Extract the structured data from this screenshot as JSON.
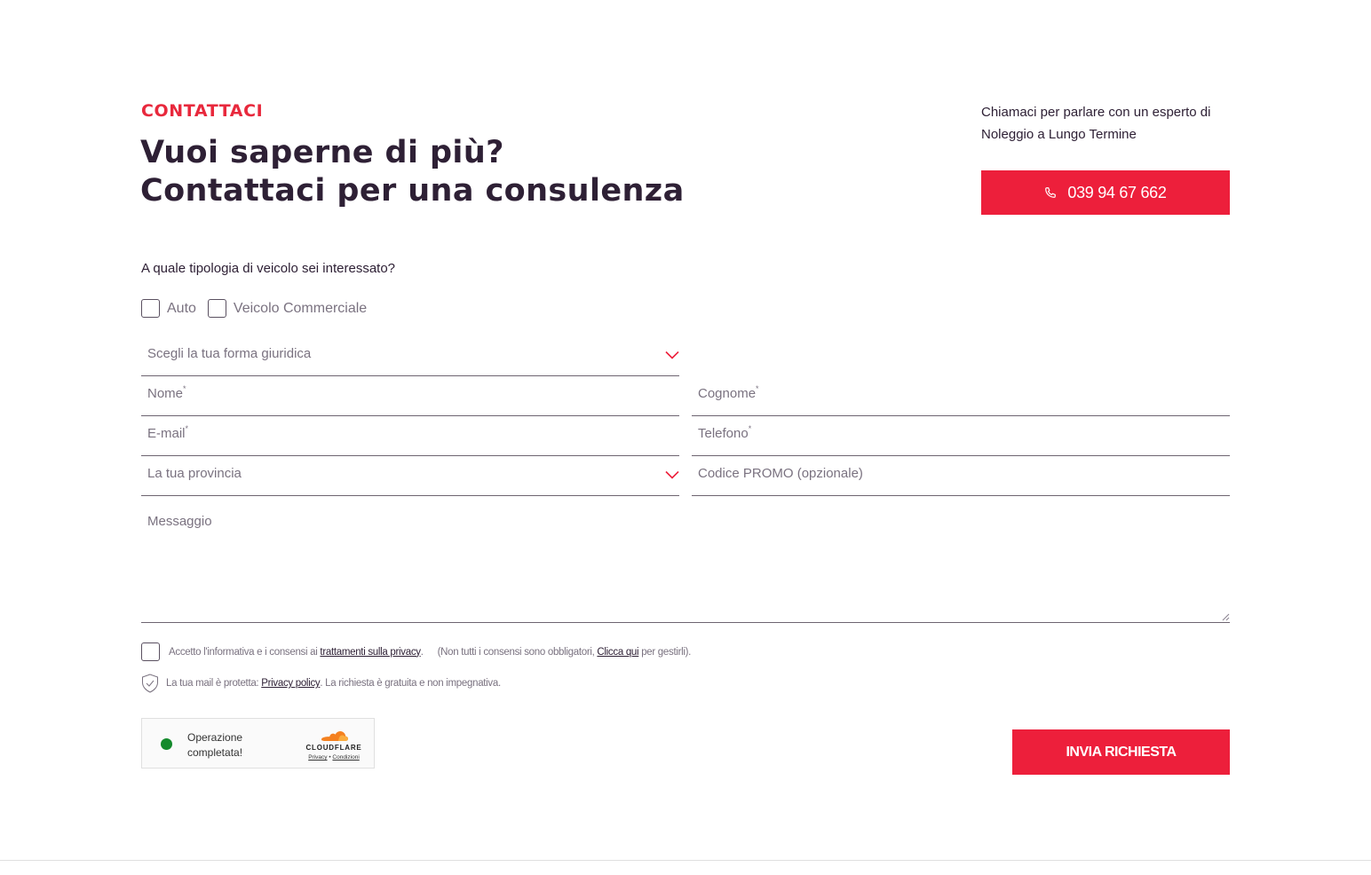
{
  "header": {
    "eyebrow": "CONTATTACI",
    "headline_line1": "Vuoi saperne di più?",
    "headline_line2": "Contattaci per una consulenza"
  },
  "callout": {
    "text_line1": "Chiamaci per parlare con un esperto di",
    "text_line2": "Noleggio a Lungo Termine",
    "phone_number": "039 94 67 662",
    "phone_icon": "phone-icon"
  },
  "form": {
    "vehicle_question": "A quale tipologia di veicolo sei interessato?",
    "vehicle_options": [
      {
        "label": "Auto",
        "checked": false
      },
      {
        "label": "Veicolo Commerciale",
        "checked": false
      }
    ],
    "legal_form": {
      "label": "Scegli la tua forma giuridica",
      "icon": "chevron-down-icon"
    },
    "first_name": {
      "label": "Nome",
      "required_mark": "*"
    },
    "last_name": {
      "label": "Cognome",
      "required_mark": "*"
    },
    "email": {
      "label": "E-mail",
      "required_mark": "*"
    },
    "phone": {
      "label": "Telefono",
      "required_mark": "*"
    },
    "province": {
      "label": "La tua provincia",
      "icon": "chevron-down-icon"
    },
    "promo": {
      "label": "Codice PROMO (opzionale)"
    },
    "message": {
      "label": "Messaggio"
    },
    "consent": {
      "prefix": "Accetto l'informativa e i consensi ai",
      "link1": "trattamenti sulla privacy",
      "sep": ".",
      "note_prefix": "(Non tutti i consensi sono obbligatori,",
      "link2": "Clicca qui",
      "note_suffix": "per gestirli)."
    },
    "secure": {
      "prefix": "La tua mail è protetta:",
      "link": "Privacy policy",
      "suffix": ". La richiesta è gratuita e non impegnativa."
    },
    "submit_label": "INVIA RICHIESTA"
  },
  "turnstile": {
    "status_line1": "Operazione",
    "status_line2": "completata!",
    "brand": "CLOUDFLARE",
    "link_privacy": "Privacy",
    "link_sep": "•",
    "link_terms": "Condizioni",
    "status_color": "#148a2c"
  },
  "colors": {
    "accent": "#ed1f3b",
    "heading": "#2e2035",
    "muted": "#7a7280"
  }
}
